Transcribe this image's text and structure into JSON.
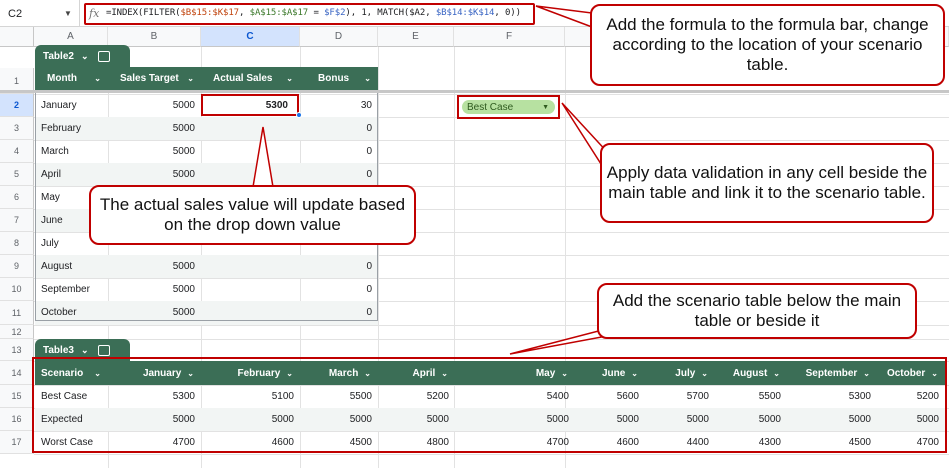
{
  "formula_bar": {
    "cell_ref": "C2",
    "fx_icon": "fx-icon",
    "formula_parts": [
      {
        "t": "=INDEX(FILTER(",
        "c": "k"
      },
      {
        "t": "$B$15:$K$17",
        "c": "r"
      },
      {
        "t": ", ",
        "c": "k"
      },
      {
        "t": "$A$15:$A$17",
        "c": "g"
      },
      {
        "t": " = ",
        "c": "k"
      },
      {
        "t": "$F$2",
        "c": "b"
      },
      {
        "t": "), 1, MATCH(",
        "c": "k"
      },
      {
        "t": "$A2",
        "c": "k"
      },
      {
        "t": ", ",
        "c": "k"
      },
      {
        "t": "$B$14:$K$14",
        "c": "b"
      },
      {
        "t": ", 0))",
        "c": "k"
      }
    ]
  },
  "columns": [
    "A",
    "B",
    "C",
    "D",
    "E",
    "F"
  ],
  "rows": [
    "1",
    "2",
    "3",
    "4",
    "5",
    "6",
    "7",
    "8",
    "9",
    "10",
    "11",
    "12",
    "13",
    "14",
    "15",
    "16",
    "17"
  ],
  "table2": {
    "name": "Table2",
    "headers": [
      "Month",
      "Sales Target",
      "Actual Sales",
      "Bonus"
    ],
    "rows": [
      [
        "January",
        "5000",
        "5300",
        "30"
      ],
      [
        "February",
        "5000",
        "",
        "0"
      ],
      [
        "March",
        "5000",
        "",
        "0"
      ],
      [
        "April",
        "5000",
        "",
        "0"
      ],
      [
        "May",
        "",
        "",
        ""
      ],
      [
        "June",
        "",
        "",
        ""
      ],
      [
        "July",
        "",
        "",
        ""
      ],
      [
        "August",
        "5000",
        "",
        "0"
      ],
      [
        "September",
        "5000",
        "",
        "0"
      ],
      [
        "October",
        "5000",
        "",
        "0"
      ]
    ]
  },
  "dropdown": {
    "value": "Best Case"
  },
  "table3": {
    "name": "Table3",
    "headers": [
      "Scenario",
      "January",
      "February",
      "March",
      "April",
      "May",
      "June",
      "July",
      "August",
      "September",
      "October"
    ],
    "rows": [
      [
        "Best Case",
        "5300",
        "5100",
        "5500",
        "5200",
        "5400",
        "5600",
        "5700",
        "5500",
        "5300",
        "5200"
      ],
      [
        "Expected",
        "5000",
        "5000",
        "5000",
        "5000",
        "5000",
        "5000",
        "5000",
        "5000",
        "5000",
        "5000"
      ],
      [
        "Worst Case",
        "4700",
        "4600",
        "4500",
        "4800",
        "4700",
        "4600",
        "4400",
        "4300",
        "4500",
        "4700"
      ]
    ]
  },
  "callouts": {
    "formula": "Add the formula to the formula bar, change according to the location of your scenario table.",
    "actual": "The actual sales value will update based on the drop down value",
    "validation": "Apply data validation in any cell beside the main table and link it to the scenario table.",
    "scenario": "Add the scenario table below the main table or beside it"
  }
}
